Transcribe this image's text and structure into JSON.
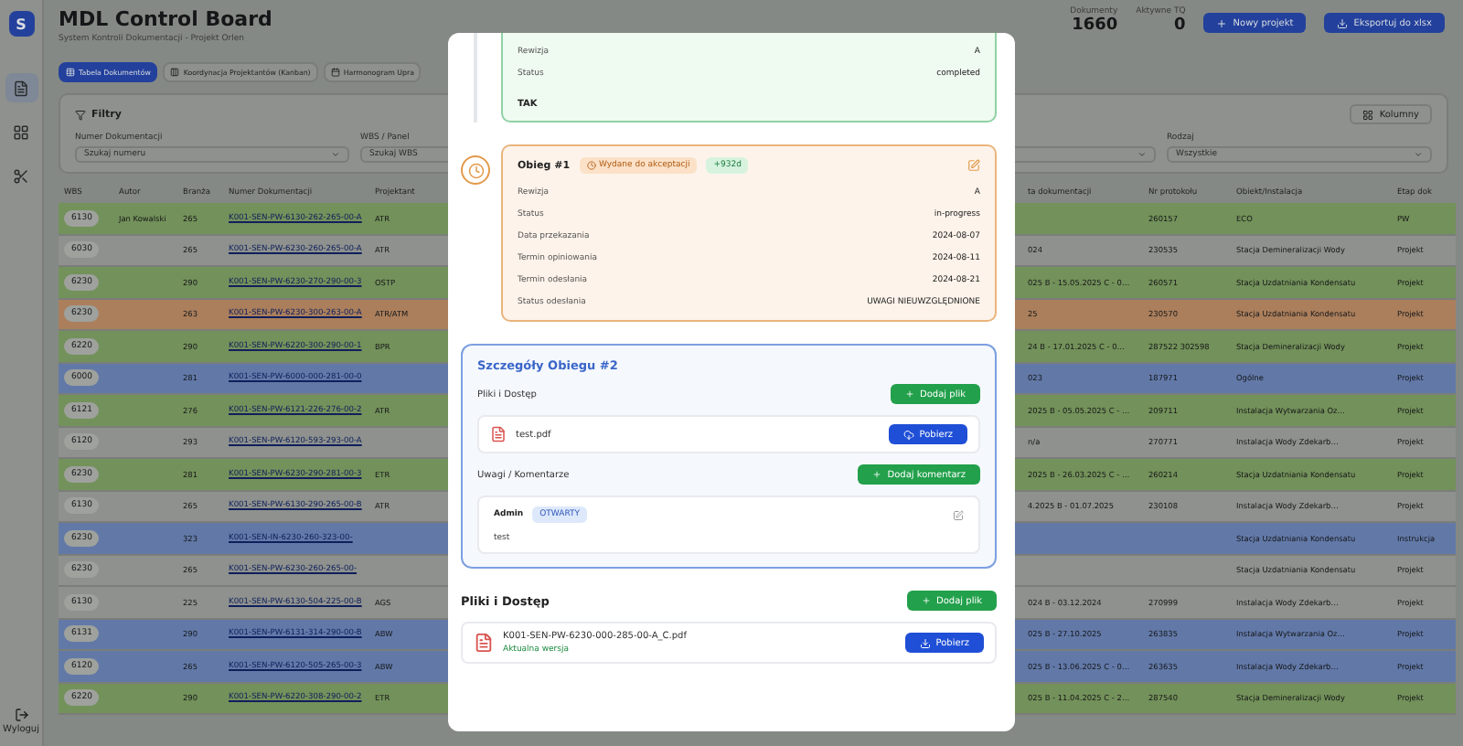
{
  "sidebar": {
    "logo": "S",
    "items": [
      {
        "kind": "documents",
        "selected": true
      },
      {
        "kind": "grid",
        "selected": false
      },
      {
        "kind": "tools",
        "selected": false
      }
    ],
    "logout": "Wyloguj"
  },
  "header": {
    "title": "MDL Control Board",
    "subtitle": "System Kontroli Dokumentacji - Projekt Orlen",
    "stats": [
      {
        "label": "Dokumenty",
        "value": "1660"
      },
      {
        "label": "Aktywne TQ",
        "value": "0"
      }
    ],
    "buttons": [
      {
        "kind": "add",
        "label": "Nowy projekt"
      },
      {
        "kind": "export",
        "label": "Eksportuj do xlsx"
      }
    ]
  },
  "tabs": [
    {
      "kind": "table",
      "label": "Tabela Dokumentów",
      "selected": true
    },
    {
      "kind": "kanban",
      "label": "Koordynacja Projektantów (Kanban)",
      "selected": false
    },
    {
      "kind": "calendar",
      "label": "Harmonogram Upra",
      "selected": false
    }
  ],
  "filters": {
    "title": "Filtry",
    "columns_button": "Kolumny",
    "fields": [
      {
        "label": "Numer Dokumentacji",
        "placeholder": "Szukaj numeru"
      },
      {
        "label": "WBS / Panel",
        "placeholder": "Szukaj WBS"
      },
      {
        "label": "Rodzaj",
        "placeholder": "Wszystkie"
      }
    ]
  },
  "table": {
    "columns": [
      "WBS",
      "Autor",
      "Branża",
      "Numer Dokumentacji",
      "Projektant",
      "ta dokumentacji",
      "Nr protokołu",
      "Obiekt/Instalacja",
      "Etap dok"
    ],
    "rows": [
      {
        "color": "#73915a",
        "cells": [
          "6130",
          "Jan Kowalski",
          "265",
          "K001-SEN-PW-6130-262-265-00-A",
          "ATR",
          "",
          "260157",
          "ECO",
          "PW"
        ]
      },
      {
        "color": "#8e918d",
        "cells": [
          "6030",
          "",
          "265",
          "K001-SEN-PW-6230-260-265-00-A",
          "ATR",
          "024",
          "230535",
          "Stacja Demineralizacji Wody",
          "Projekt"
        ]
      },
      {
        "color": "#73915a",
        "cells": [
          "6230",
          "",
          "290",
          "K001-SEN-PW-6230-270-290-00-3",
          "OSTP",
          "025 B - 15.05.2025 C - 0…",
          "260571",
          "Stacja Uzdatniania Kondensatu",
          "Projekt"
        ]
      },
      {
        "color": "#ab7f5c",
        "cells": [
          "6230",
          "",
          "263",
          "K001-SEN-PW-6230-300-263-00-A",
          "ATR/ATM",
          "25",
          "230570",
          "Stacja Uzdatniania Kondensatu",
          "Projekt"
        ]
      },
      {
        "color": "#73915a",
        "cells": [
          "6220",
          "",
          "290",
          "K001-SEN-PW-6220-300-290-00-1",
          "BPR",
          "24 B - 17.01.2025 C - 0…",
          "287522 302598",
          "Stacja Demineralizacji Wody",
          "Projekt"
        ]
      },
      {
        "color": "#6279a8",
        "cells": [
          "6000",
          "",
          "281",
          "K001-SEN-PW-6000-000-281-00-0",
          "",
          "023",
          "187971",
          "Ogólne",
          "Projekt"
        ]
      },
      {
        "color": "#73915a",
        "cells": [
          "6121",
          "",
          "276",
          "K001-SEN-PW-6121-226-276-00-2",
          "ATR",
          "2025 B - 05.05.2025 C - …",
          "209711",
          "Instalacja Wytwarzania Oz…",
          "Projekt"
        ]
      },
      {
        "color": "#8e918d",
        "cells": [
          "6120",
          "",
          "293",
          "K001-SEN-PW-6120-593-293-00-A",
          "",
          "n/a",
          "270771",
          "Instalacja Wody Zdekarb…",
          "Projekt"
        ]
      },
      {
        "color": "#73915a",
        "cells": [
          "6230",
          "",
          "281",
          "K001-SEN-PW-6230-290-281-00-3",
          "ETR",
          "2025 B - 26.03.2025 C - …",
          "260214",
          "Stacja Uzdatniania Kondensatu",
          "Projekt"
        ]
      },
      {
        "color": "#8e918d",
        "cells": [
          "6130",
          "",
          "265",
          "K001-SEN-PW-6130-290-265-00-B",
          "ATR",
          "4.2025 B - 01.07.2025",
          "230108",
          "Instalacja Wody Zdekarb…",
          "Projekt"
        ]
      },
      {
        "color": "#6279a8",
        "cells": [
          "6230",
          "",
          "323",
          "K001-SEN-IN-6230-260-323-00-",
          "",
          "",
          "",
          "Stacja Uzdatniania Kondensatu",
          "Instrukcja"
        ]
      },
      {
        "color": "#8e918d",
        "cells": [
          "6230",
          "",
          "265",
          "K001-SEN-PW-6230-260-265-00-",
          "",
          "",
          "",
          "Stacja Uzdatniania Kondensatu",
          "Projekt"
        ]
      },
      {
        "color": "#8e918d",
        "cells": [
          "6130",
          "",
          "225",
          "K001-SEN-PW-6130-504-225-00-B",
          "AGS",
          "024 B - 03.12.2024",
          "270999",
          "Instalacja Wody Zdekarb…",
          "Projekt"
        ]
      },
      {
        "color": "#6279a8",
        "cells": [
          "6131",
          "",
          "290",
          "K001-SEN-PW-6131-314-290-00-B",
          "ABW",
          "025 B - 27.10.2025",
          "263835",
          "Instalacja Wytwarzania Oz…",
          "Projekt"
        ]
      },
      {
        "color": "#6279a8",
        "cells": [
          "6120",
          "",
          "265",
          "K001-SEN-PW-6120-505-265-00-3",
          "ABW",
          "025 B - 13.06.2025 C - 0…",
          "263635",
          "Instalacja Wody Zdekarb…",
          "Projekt"
        ]
      },
      {
        "color": "#73915a",
        "cells": [
          "6220",
          "",
          "290",
          "K001-SEN-PW-6220-308-290-00-2",
          "ETR",
          "025 B - 11.04.2025 C - 2…",
          "287540",
          "Stacja Demineralizacji Wody",
          "Projekt"
        ]
      }
    ]
  },
  "modal": {
    "prev_cycle": {
      "fields": [
        {
          "label": "Rewizja",
          "value": "A"
        },
        {
          "label": "Status",
          "value": "completed"
        }
      ],
      "note": "TAK"
    },
    "cycle": {
      "title": "Obieg #1",
      "status_badge": "Wydane do akceptacji",
      "days_badge": "+932d",
      "fields": [
        {
          "label": "Rewizja",
          "value": "A"
        },
        {
          "label": "Status",
          "value": "in-progress"
        },
        {
          "label": "Data przekazania",
          "value": "2024-08-07"
        },
        {
          "label": "Termin opiniowania",
          "value": "2024-08-11"
        },
        {
          "label": "Termin odesłania",
          "value": "2024-08-21"
        },
        {
          "label": "Status odesłania",
          "value": "UWAGI NIEUWZGLĘDNIONE"
        }
      ]
    },
    "details": {
      "title": "Szczegóły Obiegu #2",
      "files_title": "Pliki i Dostęp",
      "add_file": "Dodaj plik",
      "files": [
        {
          "name": "test.pdf",
          "download": "Pobierz"
        }
      ],
      "comments_title": "Uwagi / Komentarze",
      "add_comment": "Dodaj komentarz",
      "comments": [
        {
          "author": "Admin",
          "status": "OTWARTY",
          "text": "test"
        }
      ]
    },
    "files": {
      "title": "Pliki i Dostęp",
      "add_file": "Dodaj plik",
      "items": [
        {
          "name": "K001-SEN-PW-6230-000-285-00-A_C.pdf",
          "note": "Aktualna wersja",
          "download": "Pobierz"
        }
      ]
    }
  }
}
